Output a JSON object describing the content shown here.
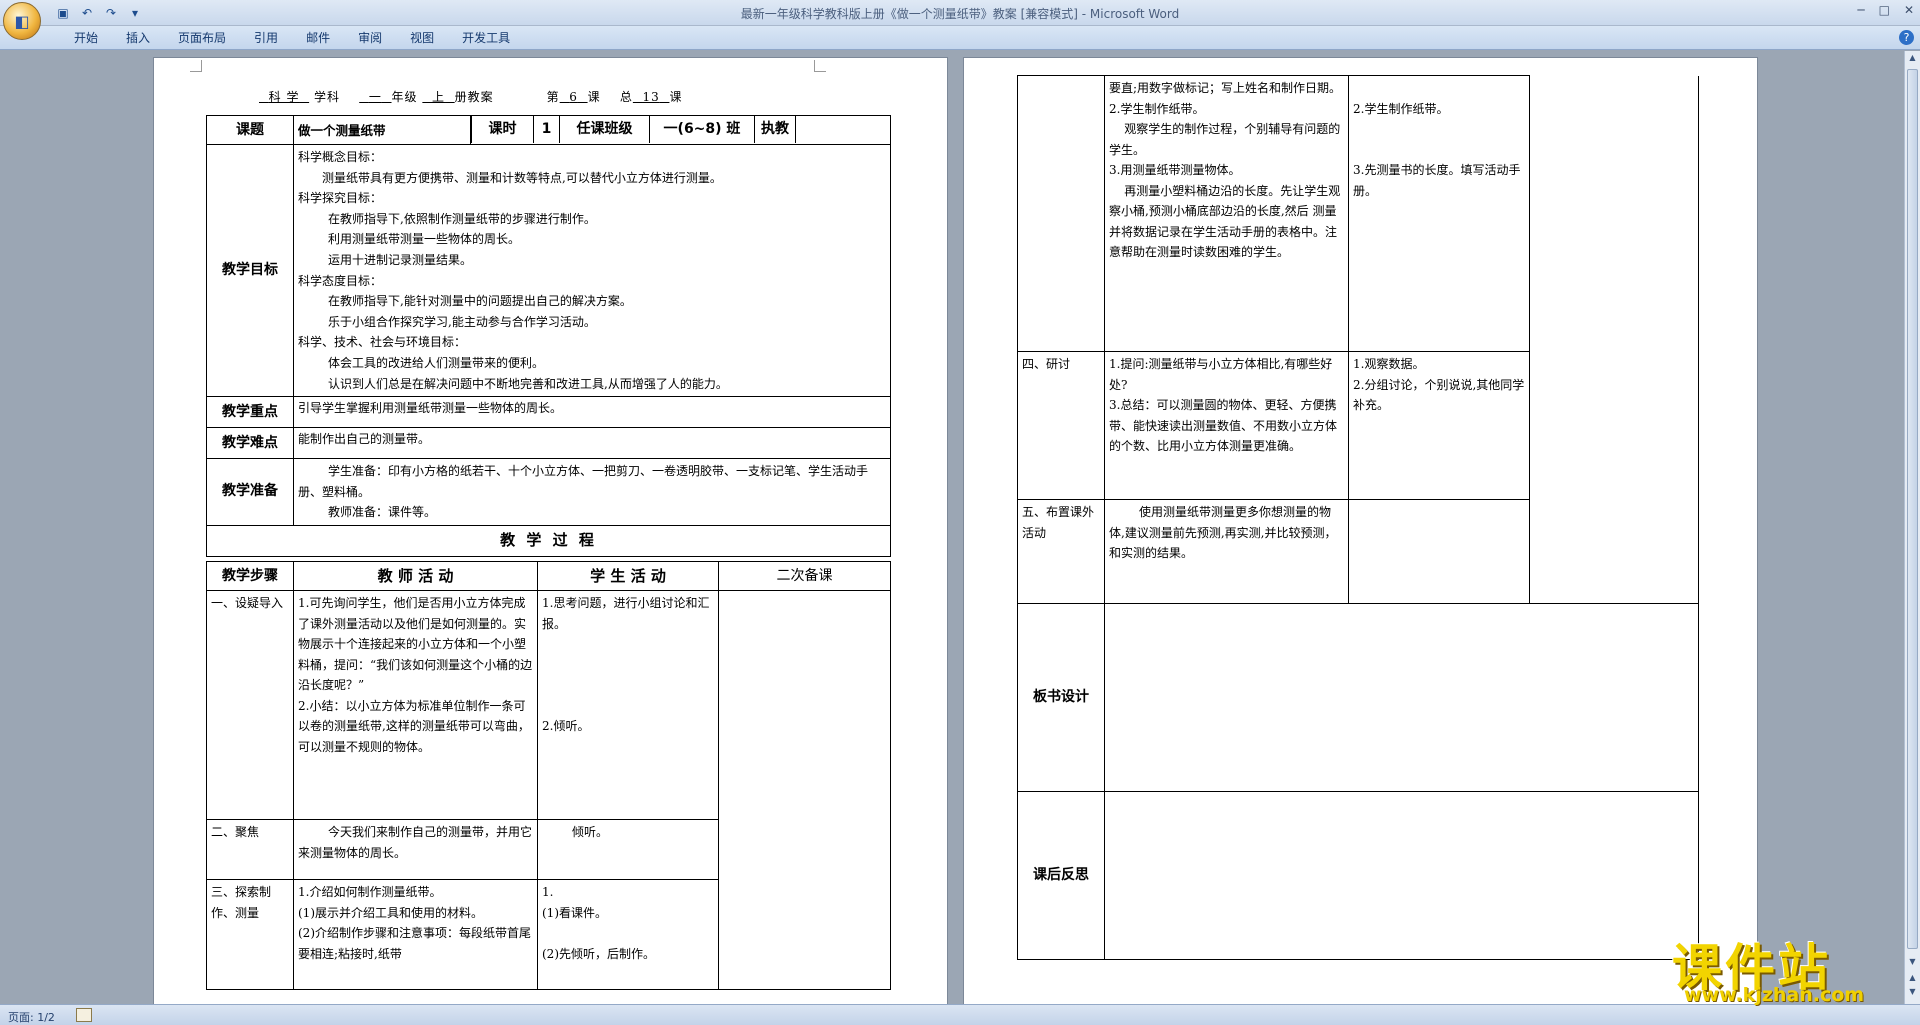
{
  "window": {
    "title": "最新一年级科学教科版上册《做一个测量纸带》教案 [兼容模式] - Microsoft Word",
    "office_button_icon": "office-logo-icon",
    "quick_access": [
      "save-icon",
      "undo-icon",
      "redo-icon",
      "customize-icon"
    ]
  },
  "ribbon": {
    "tabs": [
      "开始",
      "插入",
      "页面布局",
      "引用",
      "邮件",
      "审阅",
      "视图",
      "开发工具"
    ]
  },
  "status": {
    "page": "页面: 1/2"
  },
  "page1": {
    "header": {
      "subject": "科 学",
      "subject_label": "学科",
      "grade": "一",
      "grade_label": "年级",
      "term": "上",
      "term_label": "册教案",
      "lesson_no_prefix": "第",
      "lesson_no": "6",
      "lesson_no_suffix": "课",
      "total_prefix": "总",
      "total_no": "13",
      "total_suffix": "课"
    },
    "row1": {
      "topic_label": "课题",
      "topic": "做一个测量纸带",
      "hours_label": "课时",
      "hours": "1",
      "class_label": "任课班级",
      "class_value": "一(6~8) 班",
      "teacher_label": "执教"
    },
    "goals_label": "教学目标",
    "goals": [
      "科学概念目标：",
      "测量纸带具有更方便携带、测量和计数等特点,可以替代小立方体进行测量。",
      "科学探究目标：",
      "在教师指导下,依照制作测量纸带的步骤进行制作。",
      "利用测量纸带测量一些物体的周长。",
      "运用十进制记录测量结果。",
      "科学态度目标：",
      "在教师指导下,能针对测量中的问题提出自己的解决方案。",
      "乐于小组合作探究学习,能主动参与合作学习活动。",
      "科学、技术、社会与环境目标：",
      "体会工具的改进给人们测量带来的便利。",
      "认识到人们总是在解决问题中不断地完善和改进工具,从而增强了人的能力。"
    ],
    "key_label": "教学重点",
    "key": "引导学生掌握利用测量纸带测量一些物体的周长。",
    "difficulty_label": "教学难点",
    "difficulty": "能制作出自己的测量带。",
    "prep_label": "教学准备",
    "prep_student": "学生准备：印有小方格的纸若干、十个小立方体、一把剪刀、一卷透明胶带、一支标记笔、学生活动手册、塑料桶。",
    "prep_teacher": "教师准备：课件等。",
    "process_title": "教 学 过 程",
    "col_headers": [
      "教学步骤",
      "教 师 活 动",
      "学 生 活 动",
      "二次备课"
    ],
    "steps": [
      {
        "step": "一、设疑导入",
        "teacher": "1.可先询问学生，他们是否用小立方体完成了课外测量活动以及他们是如何测量的。实物展示十个连接起来的小立方体和一个小塑料桶，提问：“我们该如何测量这个小桶的边沿长度呢？”\n2.小结：以小立方体为标准单位制作一条可以卷的测量纸带,这样的测量纸带可以弯曲，可以测量不规则的物体。",
        "student": "1.思考问题，进行小组讨论和汇报。\n\n\n\n\n2.倾听。"
      },
      {
        "step": "二、聚焦",
        "teacher": "今天我们来制作自己的测量带，并用它来测量物体的周长。",
        "student": "倾听。"
      },
      {
        "step": "三、探索制作、测量",
        "teacher": "1.介绍如何制作测量纸带。\n(1)展示并介绍工具和使用的材料。\n(2)介绍制作步骤和注意事项：每段纸带首尾要相连;粘接时,纸带",
        "student": "1.\n(1)看课件。\n\n(2)先倾听，后制作。"
      }
    ]
  },
  "page2": {
    "cont": {
      "teacher": "要直;用数字做标记；写上姓名和制作日期。\n2.学生制作纸带。\n    观察学生的制作过程，个别辅导有问题的学生。\n3.用测量纸带测量物体。\n    再测量小塑料桶边沿的长度。先让学生观察小桶,预测小桶底部边沿的长度,然后 测量并将数据记录在学生活动手册的表格中。注意帮助在测量时读数困难的学生。",
      "student": "\n2.学生制作纸带。\n\n\n3.先测量书的长度。填写活动手册。"
    },
    "steps": [
      {
        "step": "四、研讨",
        "teacher": "1.提问:测量纸带与小立方体相比,有哪些好处?\n3.总结：可以测量圆的物体、更轻、方便携带、能快速读出测量数值、不用数小立方体的个数、比用小立方体测量更准确。",
        "student": "1.观察数据。\n2.分组讨论，个别说说,其他同学补充。"
      },
      {
        "step": "五、布置课外活动",
        "teacher": "使用测量纸带测量更多你想测量的物体,建议测量前先预测,再实测,并比较预测，和实测的结果。",
        "student": ""
      }
    ],
    "board_label": "板书设计",
    "reflection_label": "课后反思"
  },
  "watermark": {
    "text": "课件站",
    "url": "www.kjzhan.com"
  }
}
